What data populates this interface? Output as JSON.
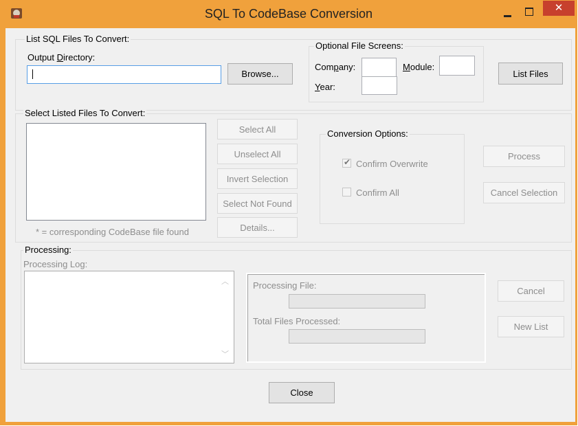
{
  "window": {
    "title": "SQL To CodeBase Conversion",
    "close_glyph": "✕"
  },
  "list_sql": {
    "group_label": "List SQL Files To Convert:",
    "output_dir_label_pre": "Output ",
    "output_dir_label_ul": "D",
    "output_dir_label_post": "irectory:",
    "output_dir_value": "",
    "browse_label": "Browse...",
    "screens_label": "Optional File Screens:",
    "company_pre": "Com",
    "company_ul": "p",
    "company_post": "any:",
    "company_value": "",
    "module_pre": "",
    "module_ul": "M",
    "module_post": "odule:",
    "module_value": "",
    "year_pre": "",
    "year_ul": "Y",
    "year_post": "ear:",
    "year_value": "",
    "list_files_label": "List Files"
  },
  "select_listed": {
    "group_label": "Select Listed Files To Convert:",
    "footnote": "* = corresponding CodeBase file found",
    "buttons": {
      "select_all": "Select All",
      "unselect_all": "Unselect All",
      "invert_selection": "Invert Selection",
      "select_not_found": "Select Not Found",
      "details": "Details..."
    },
    "conversion_options_label": "Conversion Options:",
    "confirm_overwrite_label": "Confirm Overwrite",
    "confirm_overwrite_checked": true,
    "confirm_all_label": "Confirm All",
    "confirm_all_checked": false,
    "process_label": "Process",
    "cancel_selection_label": "Cancel Selection"
  },
  "processing": {
    "group_label": "Processing:",
    "log_label": "Processing Log:",
    "processing_file_label": "Processing File:",
    "total_files_label": "Total Files Processed:",
    "cancel_label": "Cancel",
    "new_list_label": "New List"
  },
  "footer": {
    "close_label": "Close"
  },
  "colors": {
    "frame": "#f0a13c",
    "close_button": "#c7402d",
    "client_bg": "#f0f0f0"
  }
}
